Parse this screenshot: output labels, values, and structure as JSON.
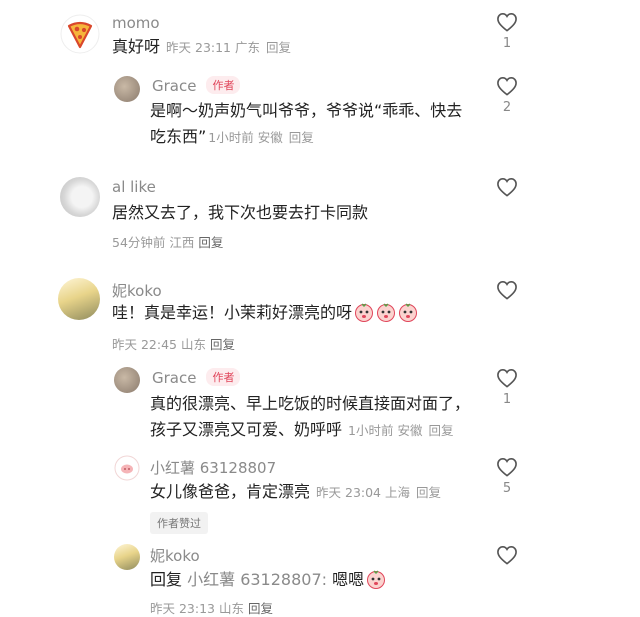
{
  "comments": [
    {
      "username": "momo",
      "text": "真好呀",
      "meta": "昨天 23:11 广东",
      "reply": "回复",
      "likes": "1",
      "replies": [
        {
          "username": "Grace",
          "badge": "作者",
          "line1": "是啊～奶声奶气叫爷爷，爷爷说“乖乖、快去",
          "line2": "吃东西”",
          "meta": "1小时前 安徽",
          "reply": "回复",
          "likes": "2"
        }
      ]
    },
    {
      "username": "al like",
      "text": "居然又去了，我下次也要去打卡同款",
      "meta": "54分钟前 江西",
      "reply": "回复"
    },
    {
      "username": "妮koko",
      "text": "哇！真是幸运！小茉莉好漂亮的呀",
      "meta": "昨天 22:45 山东",
      "reply": "回复",
      "replies": [
        {
          "username": "Grace",
          "badge": "作者",
          "line1": "真的很漂亮、早上吃饭的时候直接面对面了，",
          "line2": "孩子又漂亮又可爱、奶呼呼",
          "meta": "1小时前 安徽",
          "reply": "回复",
          "likes": "1"
        },
        {
          "username": "小红薯 63128807",
          "text": "女儿像爸爸，肯定漂亮",
          "meta": "昨天 23:04 上海",
          "reply": "回复",
          "likes": "5",
          "author_liked": "作者赞过"
        },
        {
          "username": "妮koko",
          "text_prefix": "回复",
          "mention": "小红薯 63128807:",
          "text": "嗯嗯",
          "meta": "昨天 23:13 山东",
          "reply": "回复"
        }
      ]
    }
  ],
  "colors": {
    "author_badge": "#e0455a",
    "meta": "#999999",
    "name": "#8a8a8a"
  }
}
